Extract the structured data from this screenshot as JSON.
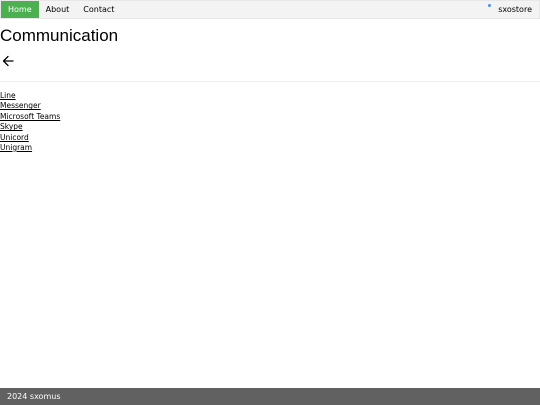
{
  "nav": {
    "items": [
      {
        "label": "Home",
        "active": true
      },
      {
        "label": "About",
        "active": false
      },
      {
        "label": "Contact",
        "active": false
      }
    ],
    "brand": "sxostore"
  },
  "main": {
    "title": "Communication",
    "back_icon": "arrow-left-icon",
    "links": [
      "Line",
      "Messenger",
      "Microsoft Teams",
      "Skype",
      "Unicord",
      "Unigram"
    ]
  },
  "footer": {
    "text": "2024 sxomus"
  },
  "colors": {
    "nav_active": "#4caf50",
    "nav_bg": "#f3f3f3",
    "footer_bg": "#616161",
    "indicator_dot": "#4a90e2"
  }
}
